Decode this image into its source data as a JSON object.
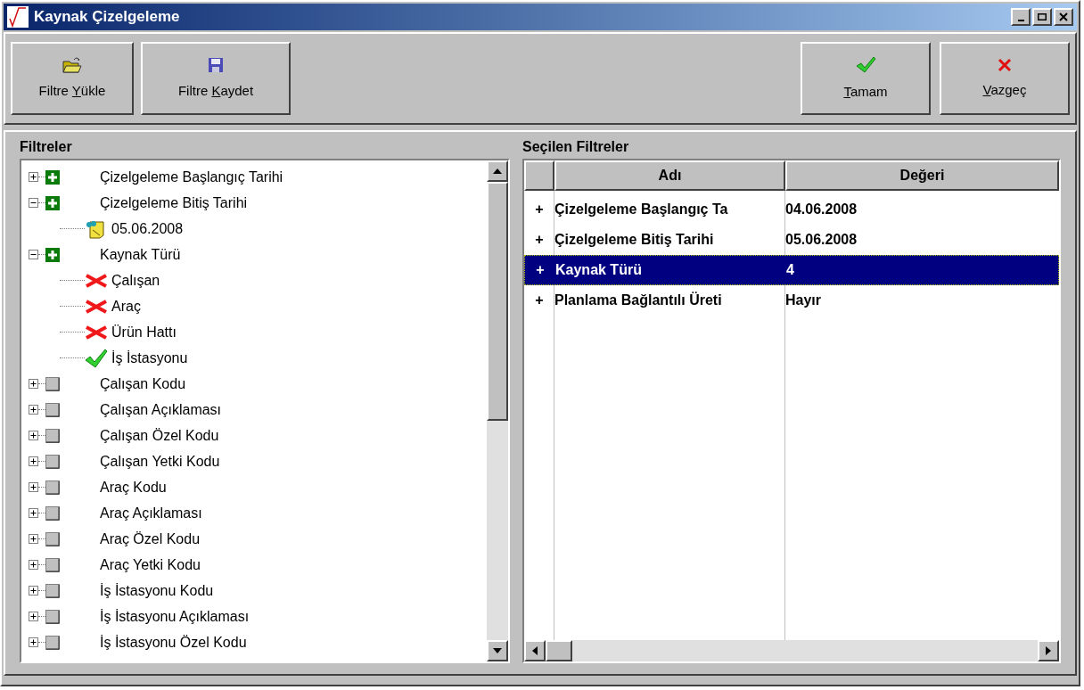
{
  "window": {
    "title": "Kaynak Çizelgeleme"
  },
  "toolbar": {
    "left": [
      {
        "kind": "open",
        "label_parts": [
          {
            "text": "Filtre ",
            "underline": false
          },
          {
            "text": "Y",
            "underline": true
          },
          {
            "text": "ükle",
            "underline": false
          }
        ]
      },
      {
        "kind": "save",
        "label_parts": [
          {
            "text": "Filtre ",
            "underline": false
          },
          {
            "text": "K",
            "underline": true
          },
          {
            "text": "aydet",
            "underline": false
          }
        ]
      }
    ],
    "right": [
      {
        "kind": "ok",
        "label_parts": [
          {
            "text": "T",
            "underline": true
          },
          {
            "text": "amam",
            "underline": false
          }
        ]
      },
      {
        "kind": "cancel",
        "label_parts": [
          {
            "text": "V",
            "underline": true
          },
          {
            "text": "azgeç",
            "underline": false
          }
        ]
      }
    ]
  },
  "filters": {
    "title": "Filtreler",
    "items": [
      {
        "label": "Çizelgeleme Başlangıç Tarihi",
        "expanded": false,
        "active": true
      },
      {
        "label": "Çizelgeleme Bitiş Tarihi",
        "expanded": true,
        "active": true,
        "children": [
          {
            "kind": "value",
            "label": "05.06.2008"
          }
        ]
      },
      {
        "label": "Kaynak Türü",
        "expanded": true,
        "active": true,
        "children": [
          {
            "kind": "excluded",
            "label": "Çalışan"
          },
          {
            "kind": "excluded",
            "label": "Araç"
          },
          {
            "kind": "excluded",
            "label": "Ürün Hattı"
          },
          {
            "kind": "included",
            "label": "İş İstasyonu"
          }
        ]
      },
      {
        "label": "Çalışan Kodu",
        "expanded": false,
        "active": false
      },
      {
        "label": "Çalışan Açıklaması",
        "expanded": false,
        "active": false
      },
      {
        "label": "Çalışan Özel Kodu",
        "expanded": false,
        "active": false
      },
      {
        "label": "Çalışan Yetki Kodu",
        "expanded": false,
        "active": false
      },
      {
        "label": "Araç Kodu",
        "expanded": false,
        "active": false
      },
      {
        "label": "Araç Açıklaması",
        "expanded": false,
        "active": false
      },
      {
        "label": "Araç Özel Kodu",
        "expanded": false,
        "active": false
      },
      {
        "label": "Araç Yetki Kodu",
        "expanded": false,
        "active": false
      },
      {
        "label": "İş İstasyonu Kodu",
        "expanded": false,
        "active": false
      },
      {
        "label": "İş İstasyonu Açıklaması",
        "expanded": false,
        "active": false
      },
      {
        "label": "İş İstasyonu Özel Kodu",
        "expanded": false,
        "active": false
      }
    ]
  },
  "selected_filters": {
    "title": "Seçilen Filtreler",
    "columns": [
      "Adı",
      "Değeri"
    ],
    "rows": [
      {
        "expander": "+",
        "name": "Çizelgeleme Başlangıç Ta",
        "value": "04.06.2008",
        "selected": false
      },
      {
        "expander": "+",
        "name": "Çizelgeleme Bitiş Tarihi",
        "value": "05.06.2008",
        "selected": false
      },
      {
        "expander": "+",
        "name": "Kaynak Türü",
        "value": "4",
        "selected": true
      },
      {
        "expander": "+",
        "name": "Planlama Bağlantılı Üreti",
        "value": "Hayır",
        "selected": false
      }
    ]
  }
}
